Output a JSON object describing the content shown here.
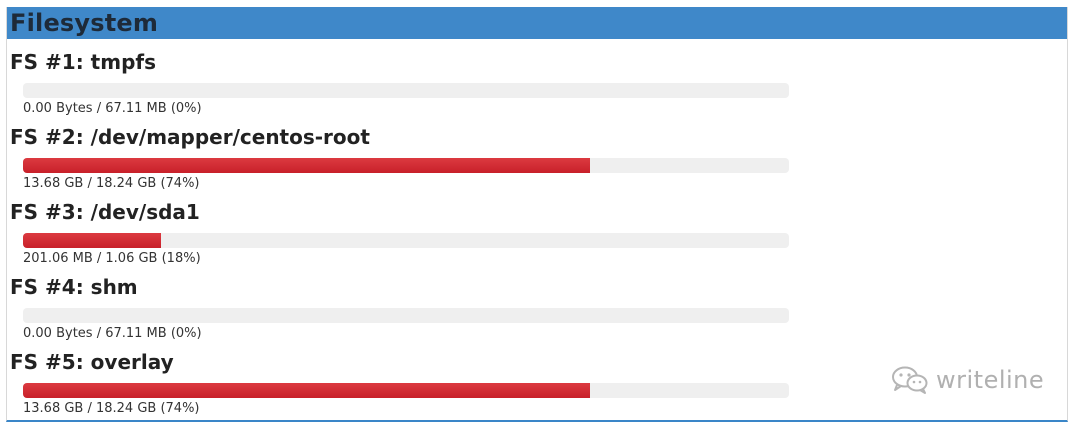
{
  "panel": {
    "title": "Filesystem",
    "header_color": "#3f88c9",
    "bar_color": "#cf2a33",
    "track_color": "#efefef"
  },
  "filesystems": [
    {
      "name": "FS #1: tmpfs",
      "usage_text": "0.00 Bytes / 67.11 MB (0%)",
      "percent": 0
    },
    {
      "name": "FS #2: /dev/mapper/centos-root",
      "usage_text": "13.68 GB / 18.24 GB (74%)",
      "percent": 74
    },
    {
      "name": "FS #3: /dev/sda1",
      "usage_text": "201.06 MB / 1.06 GB (18%)",
      "percent": 18
    },
    {
      "name": "FS #4: shm",
      "usage_text": "0.00 Bytes / 67.11 MB (0%)",
      "percent": 0
    },
    {
      "name": "FS #5: overlay",
      "usage_text": "13.68 GB / 18.24 GB (74%)",
      "percent": 74
    }
  ],
  "watermark": {
    "text": "writeline",
    "icon": "wechat-icon"
  }
}
